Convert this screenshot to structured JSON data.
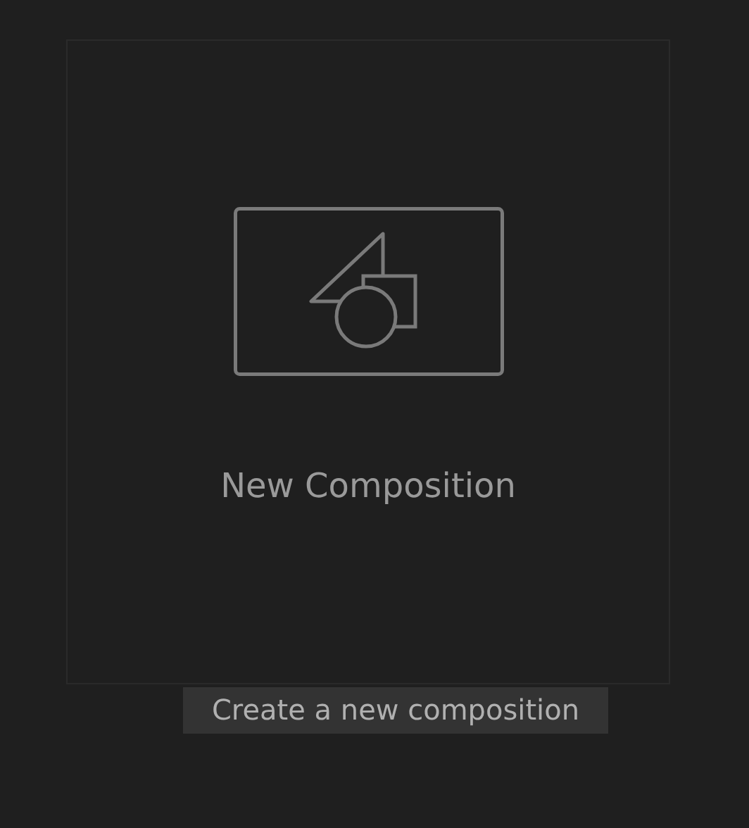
{
  "card": {
    "title": "New Composition"
  },
  "tooltip": {
    "text": "Create a new composition"
  }
}
